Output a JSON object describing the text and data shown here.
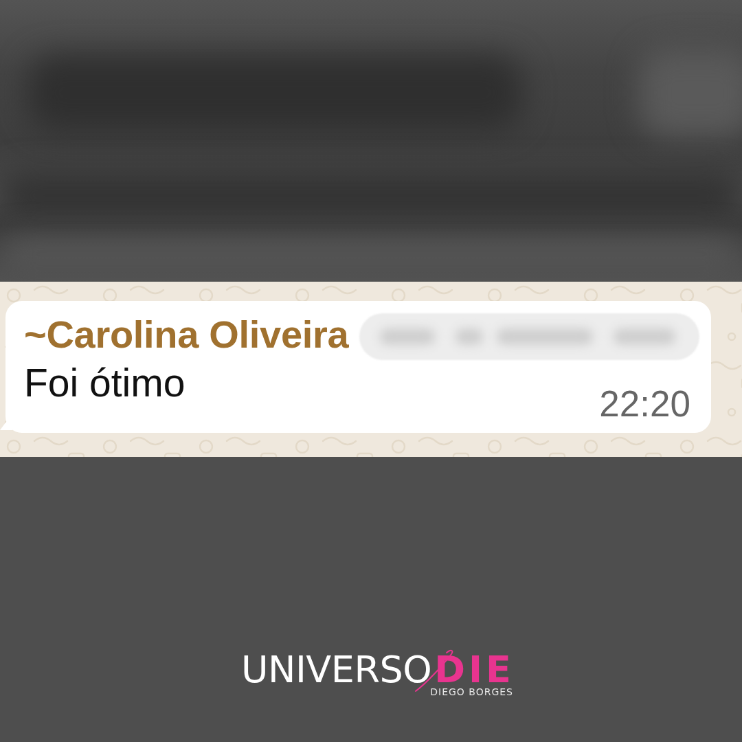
{
  "message": {
    "sender": "~Carolina Oliveira",
    "text": "Foi ótimo",
    "time": "22:20"
  },
  "logo": {
    "parts": [
      {
        "text": "UNIVERSO",
        "color": "#ffffff"
      },
      {
        "text": "DIE",
        "color": "#e8348f"
      }
    ],
    "subtitle": "DIEGO BORGES"
  }
}
